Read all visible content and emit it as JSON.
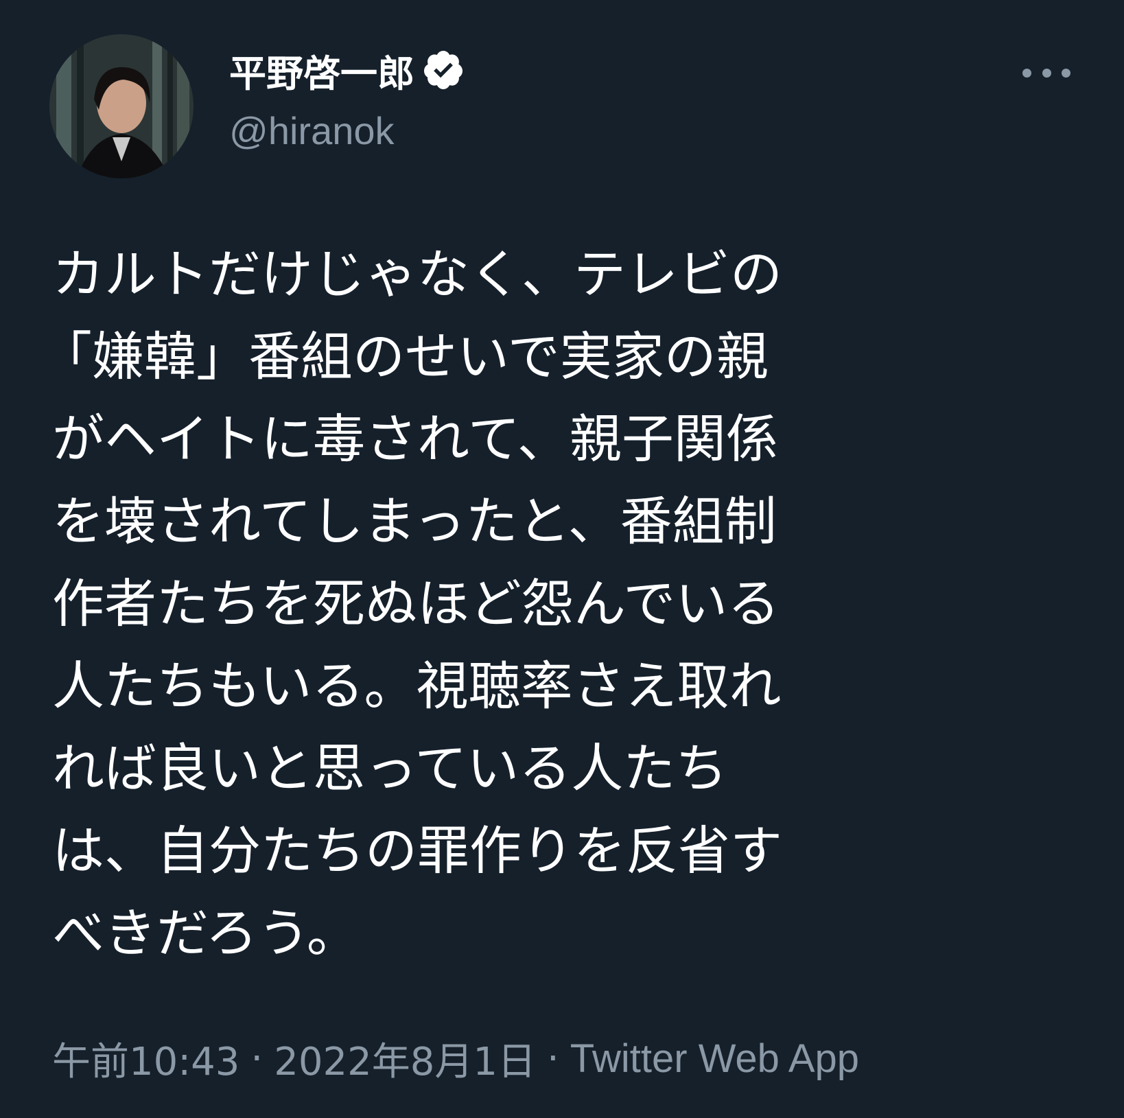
{
  "author": {
    "display_name": "平野啓一郎",
    "handle": "@hiranok",
    "verified": true,
    "verified_icon": "verified-badge-icon"
  },
  "more_icon": "more-options-icon",
  "tweet": {
    "lines": [
      "カルトだけじゃなく、テレビの",
      "「嫌韓」番組のせいで実家の親",
      "がヘイトに毒されて、親子関係",
      "を壊されてしまったと、番組制",
      "作者たちを死ぬほど怨んでいる",
      "人たちもいる。視聴率さえ取れ",
      "れば良いと思っている人たち",
      "は、自分たちの罪作りを反省す",
      "べきだろう。"
    ]
  },
  "meta": {
    "time": "午前10:43",
    "separator": "·",
    "date": "2022年8月1日",
    "source": "Twitter Web App"
  },
  "colors": {
    "background": "#15202b",
    "text": "#ffffff",
    "secondary": "#8b98a5"
  }
}
